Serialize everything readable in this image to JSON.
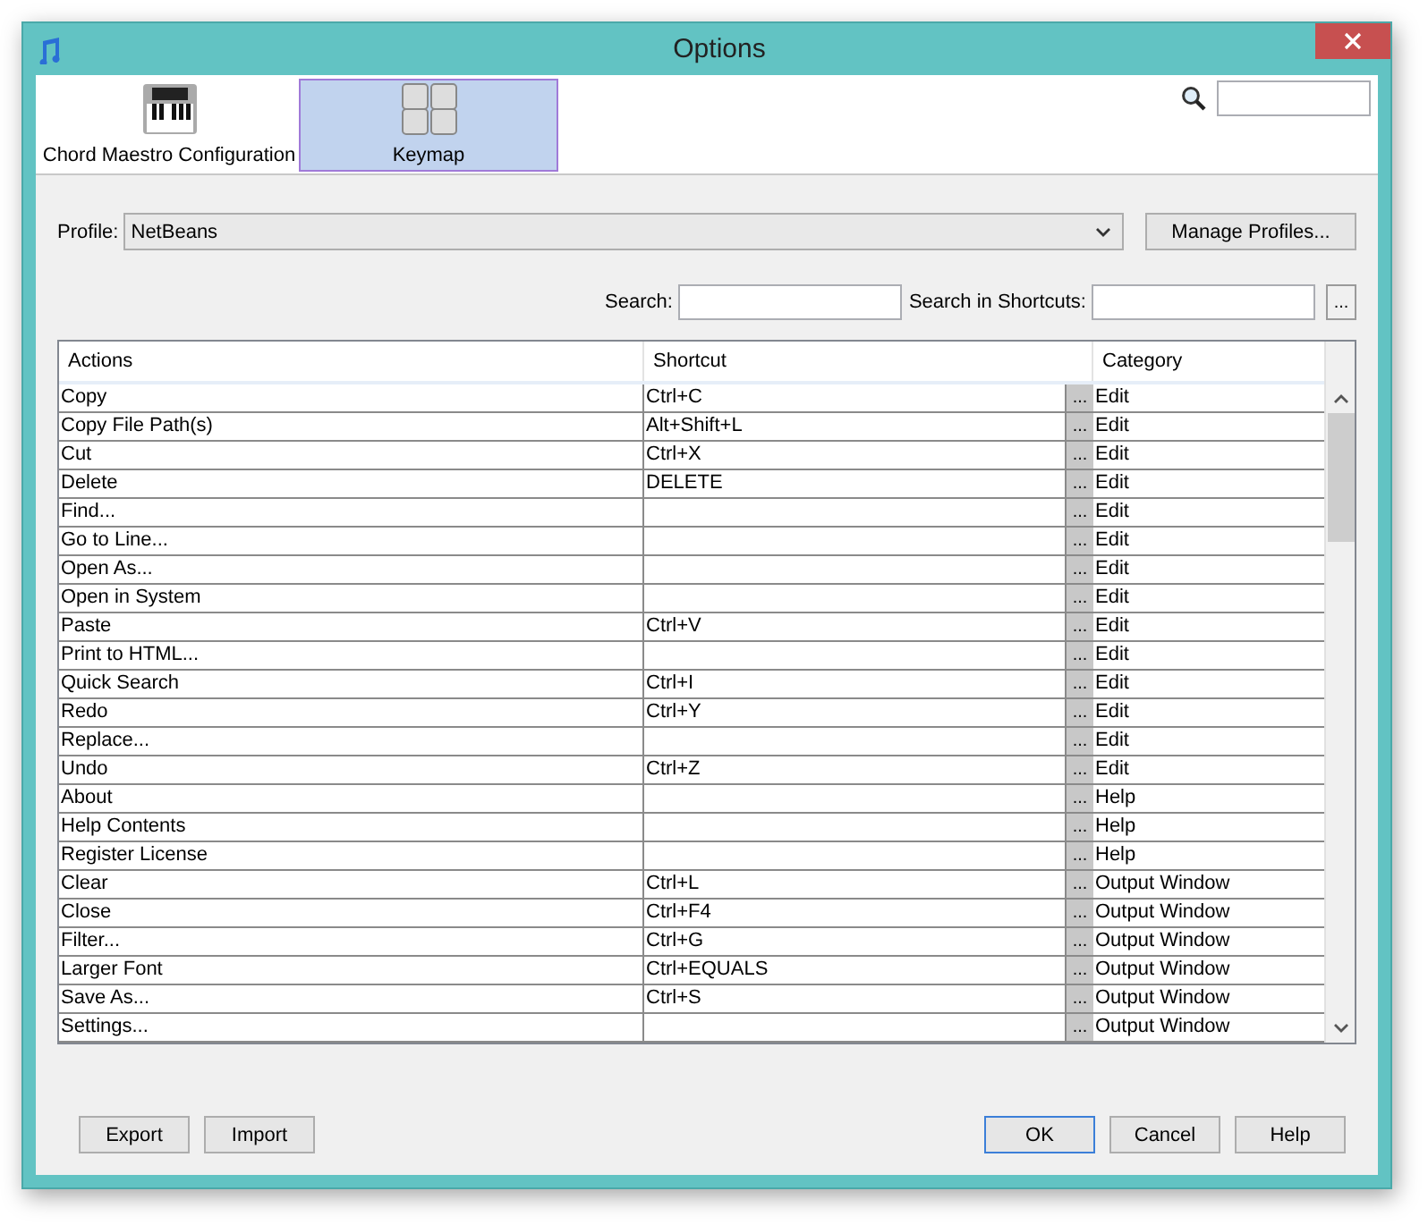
{
  "window": {
    "title": "Options"
  },
  "categories": [
    {
      "label": "Chord Maestro Configuration",
      "kind": "piano",
      "selected": false
    },
    {
      "label": "Keymap",
      "kind": "keys",
      "selected": true
    }
  ],
  "profile": {
    "label": "Profile:",
    "value": "NetBeans",
    "manage_button": "Manage Profiles..."
  },
  "search": {
    "label": "Search:",
    "shortcuts_label": "Search in Shortcuts:",
    "more_button": "..."
  },
  "table": {
    "columns": [
      "Actions",
      "Shortcut",
      "Category"
    ],
    "rows": [
      {
        "action": "Copy",
        "shortcut": "Ctrl+C",
        "button": "...",
        "category": "Edit"
      },
      {
        "action": "Copy File Path(s)",
        "shortcut": "Alt+Shift+L",
        "button": "...",
        "category": "Edit"
      },
      {
        "action": "Cut",
        "shortcut": "Ctrl+X",
        "button": "...",
        "category": "Edit"
      },
      {
        "action": "Delete",
        "shortcut": "DELETE",
        "button": "...",
        "category": "Edit"
      },
      {
        "action": "Find...",
        "button": "...",
        "category": "Edit"
      },
      {
        "action": "Go to Line...",
        "button": "...",
        "category": "Edit"
      },
      {
        "action": "Open As...",
        "button": "...",
        "category": "Edit"
      },
      {
        "action": "Open in System",
        "button": "...",
        "category": "Edit"
      },
      {
        "action": "Paste",
        "shortcut": "Ctrl+V",
        "button": "...",
        "category": "Edit"
      },
      {
        "action": "Print to HTML...",
        "button": "...",
        "category": "Edit"
      },
      {
        "action": "Quick Search",
        "shortcut": "Ctrl+I",
        "button": "...",
        "category": "Edit"
      },
      {
        "action": "Redo",
        "shortcut": "Ctrl+Y",
        "button": "...",
        "category": "Edit"
      },
      {
        "action": "Replace...",
        "button": "...",
        "category": "Edit"
      },
      {
        "action": "Undo",
        "shortcut": "Ctrl+Z",
        "button": "...",
        "category": "Edit"
      },
      {
        "action": "About",
        "button": "...",
        "category": "Help"
      },
      {
        "action": "Help Contents",
        "button": "...",
        "category": "Help"
      },
      {
        "action": "Register License",
        "button": "...",
        "category": "Help"
      },
      {
        "action": "Clear",
        "shortcut": "Ctrl+L",
        "button": "...",
        "category": "Output Window"
      },
      {
        "action": "Close",
        "shortcut": "Ctrl+F4",
        "button": "...",
        "category": "Output Window"
      },
      {
        "action": "Filter...",
        "shortcut": "Ctrl+G",
        "button": "...",
        "category": "Output Window"
      },
      {
        "action": "Larger Font",
        "shortcut": "Ctrl+EQUALS",
        "button": "...",
        "category": "Output Window"
      },
      {
        "action": "Save As...",
        "shortcut": "Ctrl+S",
        "button": "...",
        "category": "Output Window"
      },
      {
        "action": "Settings...",
        "button": "...",
        "category": "Output Window"
      }
    ]
  },
  "buttons_left": [
    "Export",
    "Import"
  ],
  "buttons_right": [
    {
      "label": "OK",
      "default": true
    },
    {
      "label": "Cancel",
      "default": false
    },
    {
      "label": "Help",
      "default": false
    }
  ]
}
